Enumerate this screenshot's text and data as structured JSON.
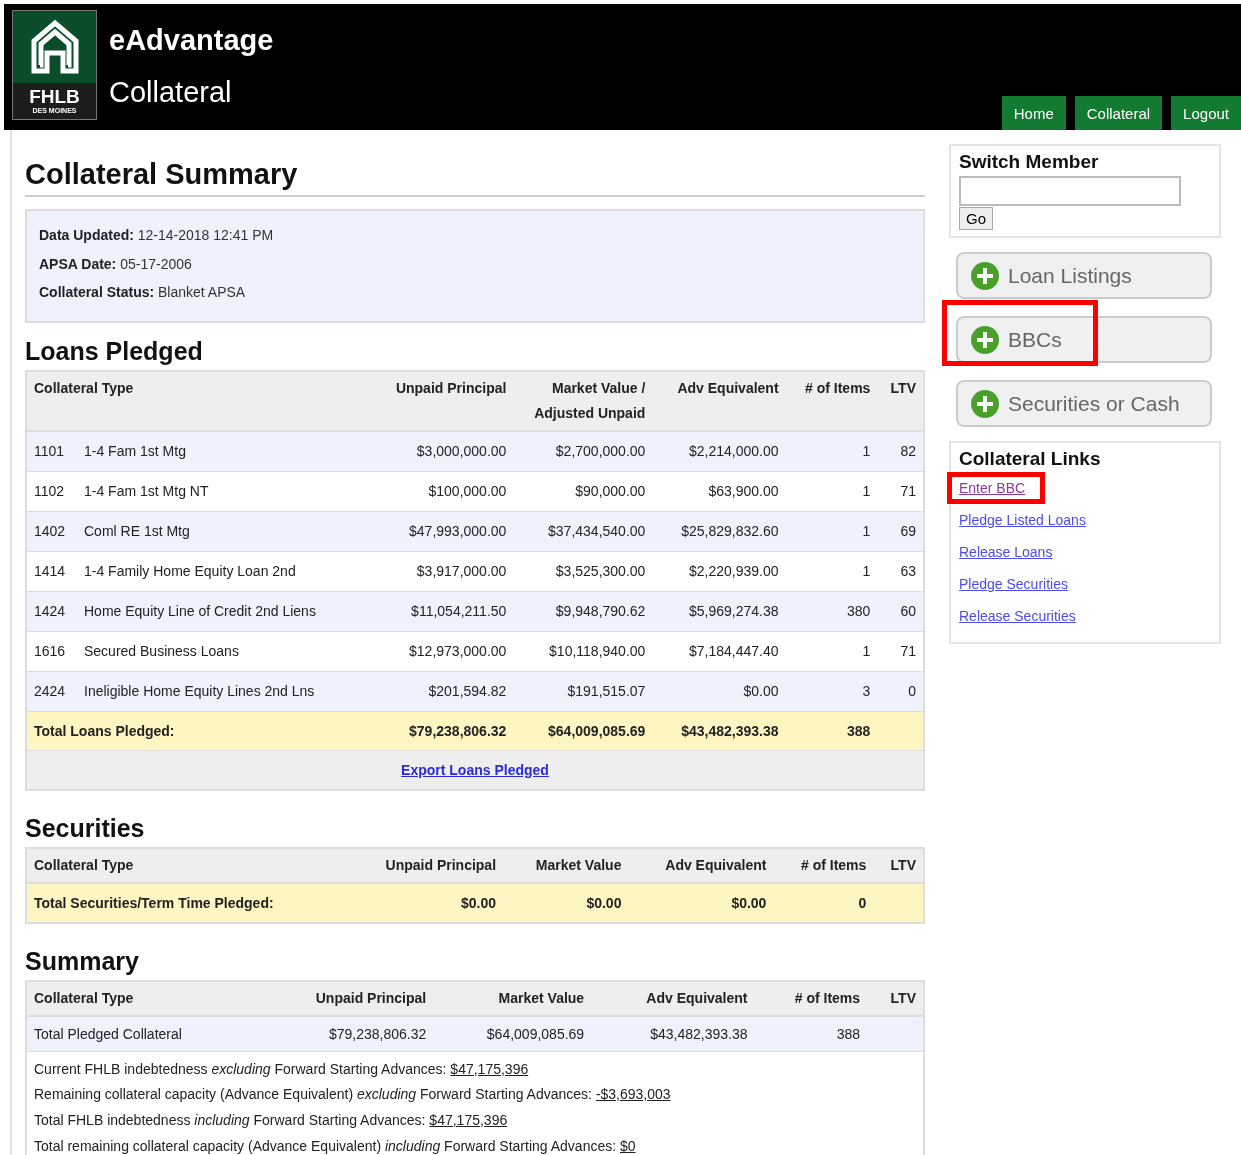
{
  "header": {
    "logo": {
      "title": "FHLB",
      "subtitle": "DES MOINES"
    },
    "app_name": "eAdvantage",
    "section": "Collateral",
    "nav": [
      {
        "label": "Home"
      },
      {
        "label": "Collateral"
      },
      {
        "label": "Logout"
      }
    ]
  },
  "page_title": "Collateral Summary",
  "info": [
    {
      "label": "Data Updated:",
      "value": "12-14-2018 12:41 PM"
    },
    {
      "label": "APSA Date:",
      "value": "05-17-2006"
    },
    {
      "label": "Collateral Status:",
      "value": "Blanket APSA"
    }
  ],
  "loans": {
    "title": "Loans Pledged",
    "columns": [
      "Collateral Type",
      "Unpaid Principal",
      "Market Value / Adjusted Unpaid",
      "Adv Equivalent",
      "# of Items",
      "LTV"
    ],
    "rows": [
      {
        "kind": "item",
        "code": "1101",
        "cells": [
          "1-4 Fam 1st Mtg",
          "$3,000,000.00",
          "$2,700,000.00",
          "$2,214,000.00",
          "1",
          "82"
        ]
      },
      {
        "kind": "item",
        "code": "1102",
        "cells": [
          "1-4 Fam 1st Mtg NT",
          "$100,000.00",
          "$90,000.00",
          "$63,900.00",
          "1",
          "71"
        ]
      },
      {
        "kind": "item",
        "code": "1402",
        "cells": [
          "Coml RE 1st Mtg",
          "$47,993,000.00",
          "$37,434,540.00",
          "$25,829,832.60",
          "1",
          "69"
        ]
      },
      {
        "kind": "item",
        "code": "1414",
        "cells": [
          "1-4 Family Home Equity Loan 2nd",
          "$3,917,000.00",
          "$3,525,300.00",
          "$2,220,939.00",
          "1",
          "63"
        ]
      },
      {
        "kind": "item",
        "code": "1424",
        "cells": [
          "Home Equity Line of Credit 2nd Liens",
          "$11,054,211.50",
          "$9,948,790.62",
          "$5,969,274.38",
          "380",
          "60"
        ]
      },
      {
        "kind": "item",
        "code": "1616",
        "cells": [
          "Secured Business Loans",
          "$12,973,000.00",
          "$10,118,940.00",
          "$7,184,447.40",
          "1",
          "71"
        ]
      },
      {
        "kind": "item",
        "code": "2424",
        "cells": [
          "Ineligible Home Equity Lines 2nd Lns",
          "$201,594.82",
          "$191,515.07",
          "$0.00",
          "3",
          "0"
        ]
      },
      {
        "kind": "total",
        "cells": [
          "Total Loans Pledged:",
          "$79,238,806.32",
          "$64,009,085.69",
          "$43,482,393.38",
          "388",
          ""
        ]
      }
    ],
    "export_link": "Export Loans Pledged"
  },
  "securities": {
    "title": "Securities",
    "columns": [
      "Collateral Type",
      "Unpaid Principal",
      "Market Value",
      "Adv Equivalent",
      "# of Items",
      "LTV"
    ],
    "rows": [
      {
        "kind": "total",
        "cells": [
          "Total Securities/Term Time Pledged:",
          "$0.00",
          "$0.00",
          "$0.00",
          "0",
          ""
        ]
      }
    ]
  },
  "summary": {
    "title": "Summary",
    "columns": [
      "Collateral Type",
      "Unpaid Principal",
      "Market Value",
      "Adv Equivalent",
      "# of Items",
      "LTV"
    ],
    "rows": [
      {
        "kind": "summary",
        "cells": [
          "Total Pledged Collateral",
          "$79,238,806.32",
          "$64,009,085.69",
          "$43,482,393.38",
          "388",
          ""
        ]
      }
    ],
    "notes": [
      {
        "text": "Current FHLB indebtedness *excluding* Forward Starting Advances:",
        "amount": "$47,175,396"
      },
      {
        "text": "Remaining collateral capacity (Advance Equivalent) *excluding* Forward Starting Advances:",
        "amount": "-$3,693,003"
      },
      {
        "text": "Total FHLB indebtedness *including* Forward Starting Advances:",
        "amount": "$47,175,396"
      },
      {
        "text": "Total remaining collateral capacity (Advance Equivalent) *including* Forward Starting Advances:",
        "amount": "$0"
      }
    ]
  },
  "sidebar": {
    "switch_member": {
      "title": "Switch Member",
      "button": "Go"
    },
    "buttons": [
      {
        "label": "Loan Listings",
        "highlighted": false
      },
      {
        "label": "BBCs",
        "highlighted": true
      },
      {
        "label": "Securities or Cash",
        "highlighted": false
      }
    ],
    "links_title": "Collateral Links",
    "links": [
      {
        "label": "Enter BBC",
        "visited": true,
        "highlighted": true
      },
      {
        "label": "Pledge Listed Loans",
        "visited": false,
        "highlighted": false
      },
      {
        "label": "Release Loans",
        "visited": false,
        "highlighted": false
      },
      {
        "label": "Pledge Securities",
        "visited": false,
        "highlighted": false
      },
      {
        "label": "Release Securities",
        "visited": false,
        "highlighted": false
      }
    ]
  }
}
